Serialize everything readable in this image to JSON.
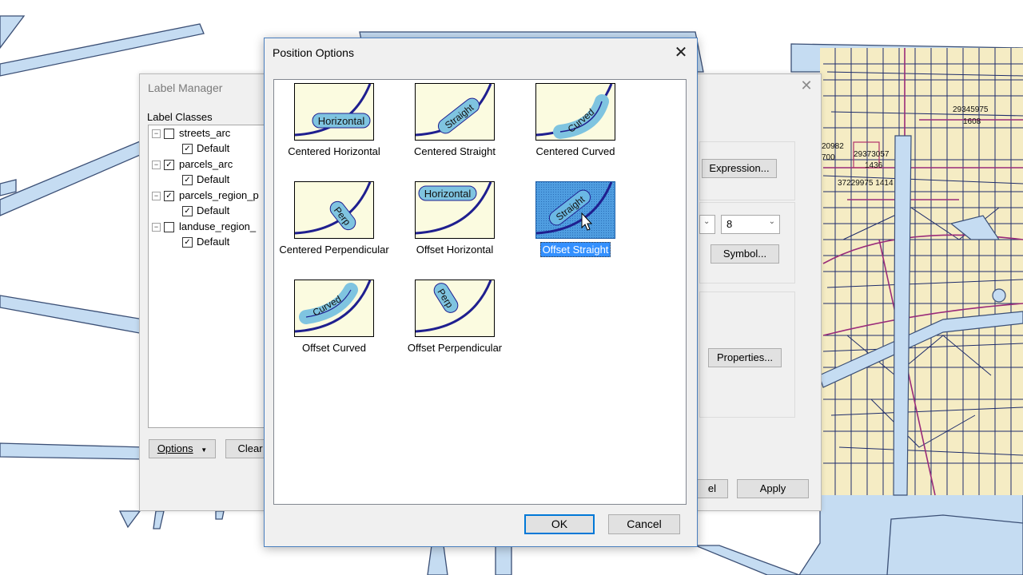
{
  "label_manager": {
    "title": "Label Manager",
    "label_classes_heading": "Label Classes",
    "tree": [
      {
        "label": "streets_arc",
        "checked": false,
        "child": "Default",
        "child_checked": true
      },
      {
        "label": "parcels_arc",
        "checked": true,
        "child": "Default",
        "child_checked": true
      },
      {
        "label": "parcels_region_p",
        "checked": true,
        "child": "Default",
        "child_checked": true
      },
      {
        "label": "landuse_region_",
        "checked": false,
        "child": "Default",
        "child_checked": true
      }
    ],
    "options_button": "Options",
    "clear_button": "Clear",
    "expression_button": "Expression...",
    "font_size_value": "8",
    "symbol_button": "Symbol...",
    "properties_button": "Properties...",
    "cancel_fragment": "el",
    "apply_button": "Apply"
  },
  "position_options": {
    "title": "Position Options",
    "options": [
      {
        "caption": "Centered Horizontal",
        "thumb_text": "Horizontal",
        "selected": false
      },
      {
        "caption": "Centered Straight",
        "thumb_text": "Straight",
        "selected": false
      },
      {
        "caption": "Centered Curved",
        "thumb_text": "Curved",
        "selected": false
      },
      {
        "caption": "Centered Perpendicular",
        "thumb_text": "Perp",
        "selected": false
      },
      {
        "caption": "Offset Horizontal",
        "thumb_text": "Horizontal",
        "selected": false
      },
      {
        "caption": "Offset Straight",
        "thumb_text": "Straight",
        "selected": true
      },
      {
        "caption": "Offset Curved",
        "thumb_text": "Curved",
        "selected": false
      },
      {
        "caption": "Offset Perpendicular",
        "thumb_text": "Perp",
        "selected": false
      }
    ],
    "ok_button": "OK",
    "cancel_button": "Cancel"
  },
  "map": {
    "parcel_labels": [
      "29345975",
      "1608",
      "20982",
      "700",
      "29373057",
      "1436",
      "37229975 1414"
    ]
  },
  "colors": {
    "map_fill": "#c5dcf2",
    "parcel_fill": "#f5ecc4",
    "selection": "#3390ff",
    "thumb_bg": "#fbfbe0",
    "curve": "#1f1f8f",
    "label_pill": "#7fc4e0"
  }
}
